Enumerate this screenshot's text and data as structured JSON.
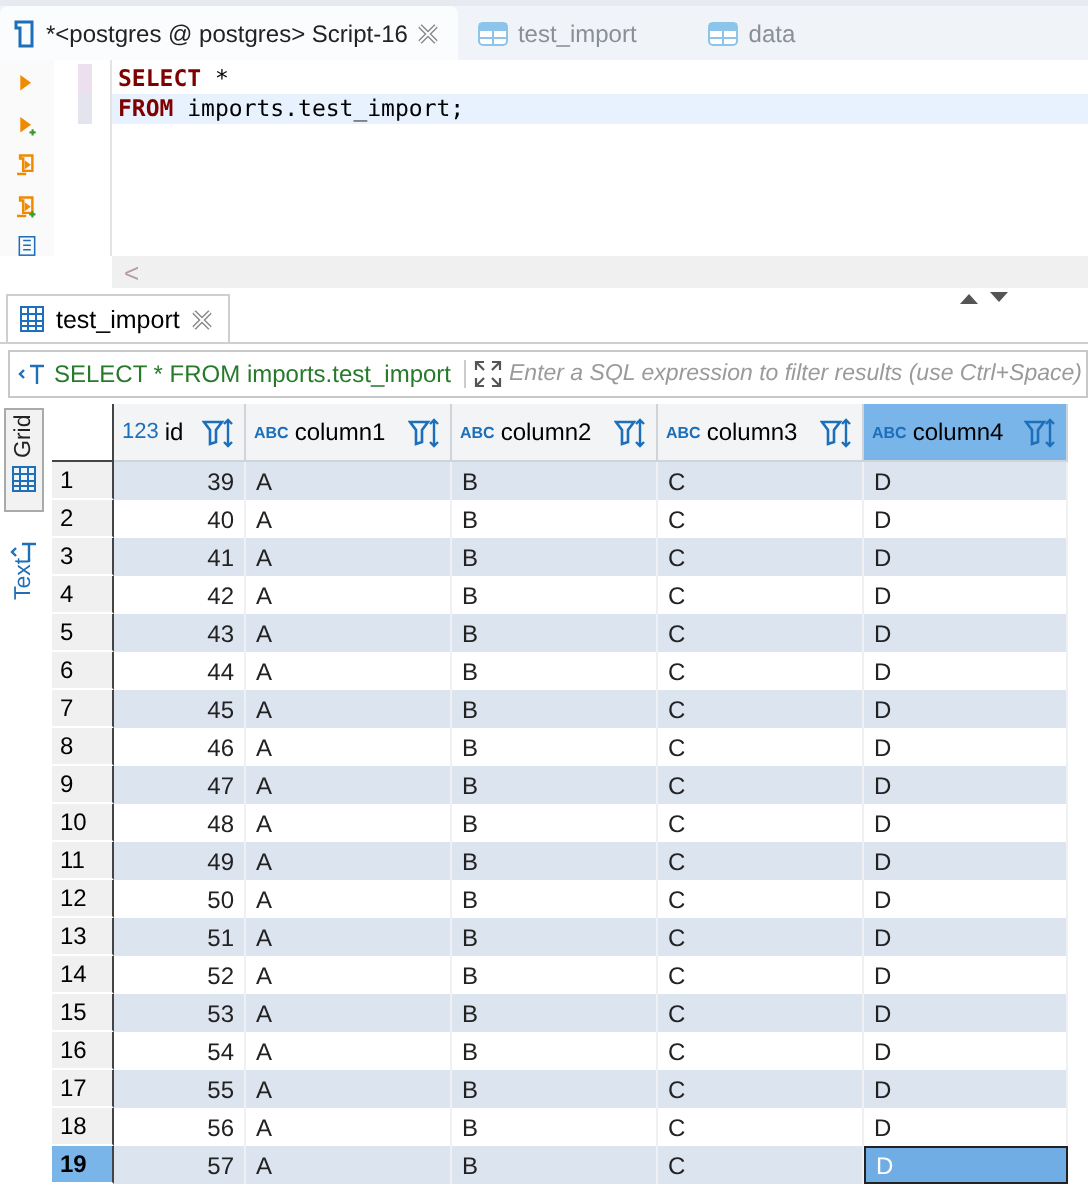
{
  "editor_tabs": [
    {
      "label": "*<postgres @ postgres> Script-16",
      "kind": "script",
      "selected": true,
      "closable": true
    },
    {
      "label": "test_import",
      "kind": "table",
      "selected": false,
      "closable": false
    },
    {
      "label": "data",
      "kind": "table",
      "selected": false,
      "closable": false
    }
  ],
  "sql_lines": [
    {
      "keyword": "SELECT",
      "rest": " *",
      "current": false
    },
    {
      "keyword": "FROM",
      "rest": " imports.test_import;",
      "current": true
    }
  ],
  "scroll_arrow": "<",
  "results_tab": {
    "label": "test_import",
    "selected": true
  },
  "filter": {
    "query": "SELECT * FROM imports.test_import",
    "placeholder": "Enter a SQL expression to filter results (use Ctrl+Space)"
  },
  "view_tabs": [
    {
      "label": "Grid",
      "selected": true
    },
    {
      "label": "Text",
      "selected": false
    }
  ],
  "columns": [
    {
      "type": "123",
      "name": "id",
      "kind": "number",
      "selected": false
    },
    {
      "type": "ABC",
      "name": "column1",
      "kind": "text",
      "selected": false
    },
    {
      "type": "ABC",
      "name": "column2",
      "kind": "text",
      "selected": false
    },
    {
      "type": "ABC",
      "name": "column3",
      "kind": "text",
      "selected": false
    },
    {
      "type": "ABC",
      "name": "column4",
      "kind": "text",
      "selected": true
    }
  ],
  "rows": [
    {
      "num": "1",
      "cells": [
        "39",
        "A",
        "B",
        "C",
        "D"
      ],
      "selected": false
    },
    {
      "num": "2",
      "cells": [
        "40",
        "A",
        "B",
        "C",
        "D"
      ],
      "selected": false
    },
    {
      "num": "3",
      "cells": [
        "41",
        "A",
        "B",
        "C",
        "D"
      ],
      "selected": false
    },
    {
      "num": "4",
      "cells": [
        "42",
        "A",
        "B",
        "C",
        "D"
      ],
      "selected": false
    },
    {
      "num": "5",
      "cells": [
        "43",
        "A",
        "B",
        "C",
        "D"
      ],
      "selected": false
    },
    {
      "num": "6",
      "cells": [
        "44",
        "A",
        "B",
        "C",
        "D"
      ],
      "selected": false
    },
    {
      "num": "7",
      "cells": [
        "45",
        "A",
        "B",
        "C",
        "D"
      ],
      "selected": false
    },
    {
      "num": "8",
      "cells": [
        "46",
        "A",
        "B",
        "C",
        "D"
      ],
      "selected": false
    },
    {
      "num": "9",
      "cells": [
        "47",
        "A",
        "B",
        "C",
        "D"
      ],
      "selected": false
    },
    {
      "num": "10",
      "cells": [
        "48",
        "A",
        "B",
        "C",
        "D"
      ],
      "selected": false
    },
    {
      "num": "11",
      "cells": [
        "49",
        "A",
        "B",
        "C",
        "D"
      ],
      "selected": false
    },
    {
      "num": "12",
      "cells": [
        "50",
        "A",
        "B",
        "C",
        "D"
      ],
      "selected": false
    },
    {
      "num": "13",
      "cells": [
        "51",
        "A",
        "B",
        "C",
        "D"
      ],
      "selected": false
    },
    {
      "num": "14",
      "cells": [
        "52",
        "A",
        "B",
        "C",
        "D"
      ],
      "selected": false
    },
    {
      "num": "15",
      "cells": [
        "53",
        "A",
        "B",
        "C",
        "D"
      ],
      "selected": false
    },
    {
      "num": "16",
      "cells": [
        "54",
        "A",
        "B",
        "C",
        "D"
      ],
      "selected": false
    },
    {
      "num": "17",
      "cells": [
        "55",
        "A",
        "B",
        "C",
        "D"
      ],
      "selected": false
    },
    {
      "num": "18",
      "cells": [
        "56",
        "A",
        "B",
        "C",
        "D"
      ],
      "selected": false
    },
    {
      "num": "19",
      "cells": [
        "57",
        "A",
        "B",
        "C",
        "D"
      ],
      "selected": true
    }
  ]
}
